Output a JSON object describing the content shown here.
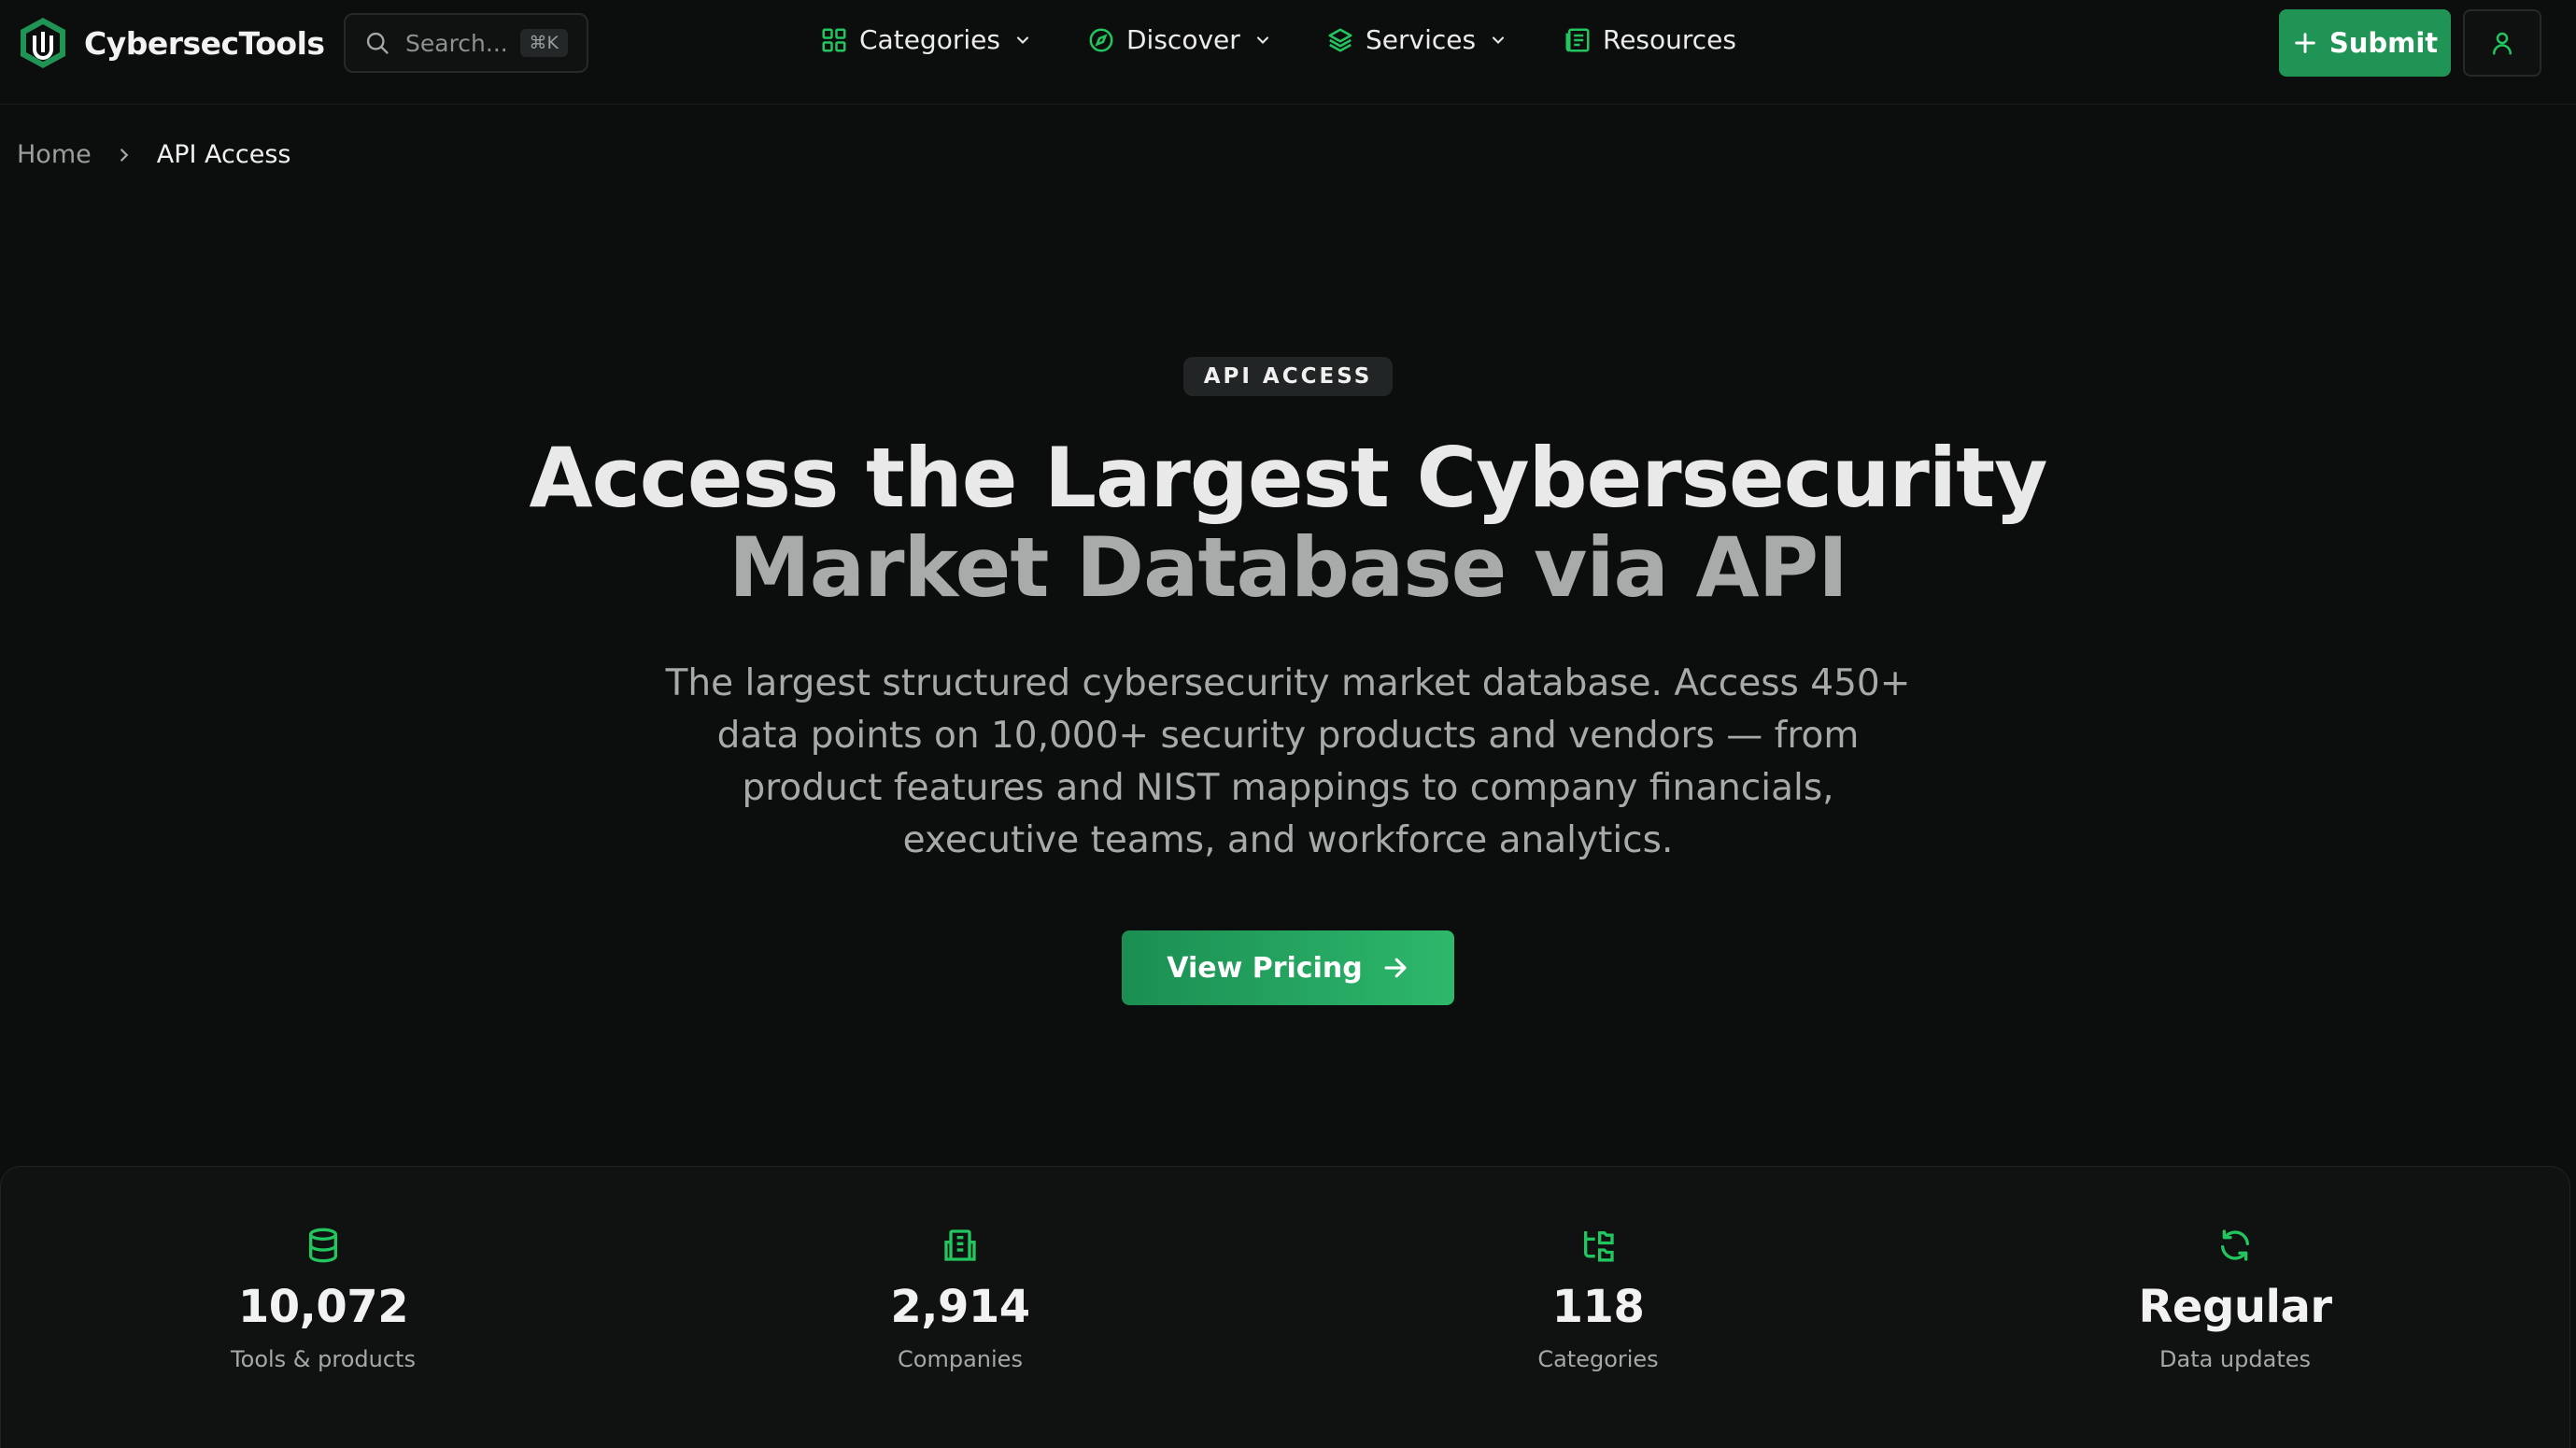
{
  "brand": {
    "name": "CybersecTools",
    "logo_icon": "hexagon-logo-icon"
  },
  "search": {
    "placeholder": "Search...",
    "shortcut": "⌘K"
  },
  "nav": {
    "items": [
      {
        "label": "Categories",
        "icon": "grid-icon",
        "has_dropdown": true
      },
      {
        "label": "Discover",
        "icon": "compass-icon",
        "has_dropdown": true
      },
      {
        "label": "Services",
        "icon": "layers-icon",
        "has_dropdown": true
      },
      {
        "label": "Resources",
        "icon": "newspaper-icon",
        "has_dropdown": false
      }
    ]
  },
  "actions": {
    "submit_label": "Submit"
  },
  "breadcrumb": {
    "home": "Home",
    "current": "API Access"
  },
  "hero": {
    "badge": "API ACCESS",
    "headline_line1": "Access the Largest Cybersecurity",
    "headline_line2": "Market Database via API",
    "description": "The largest structured cybersecurity market database. Access 450+ data points on 10,000+ security products and vendors — from product features and NIST mappings to company financials, executive teams, and workforce analytics.",
    "cta_label": "View Pricing"
  },
  "stats": [
    {
      "value": "10,072",
      "label": "Tools & products",
      "icon": "database-icon"
    },
    {
      "value": "2,914",
      "label": "Companies",
      "icon": "building-icon"
    },
    {
      "value": "118",
      "label": "Categories",
      "icon": "folder-tree-icon"
    },
    {
      "value": "Regular",
      "label": "Data updates",
      "icon": "refresh-icon"
    }
  ],
  "colors": {
    "background": "#0c0d0d",
    "accent_green": "#22c55e",
    "button_green": "#1f9454",
    "panel": "#101212"
  }
}
